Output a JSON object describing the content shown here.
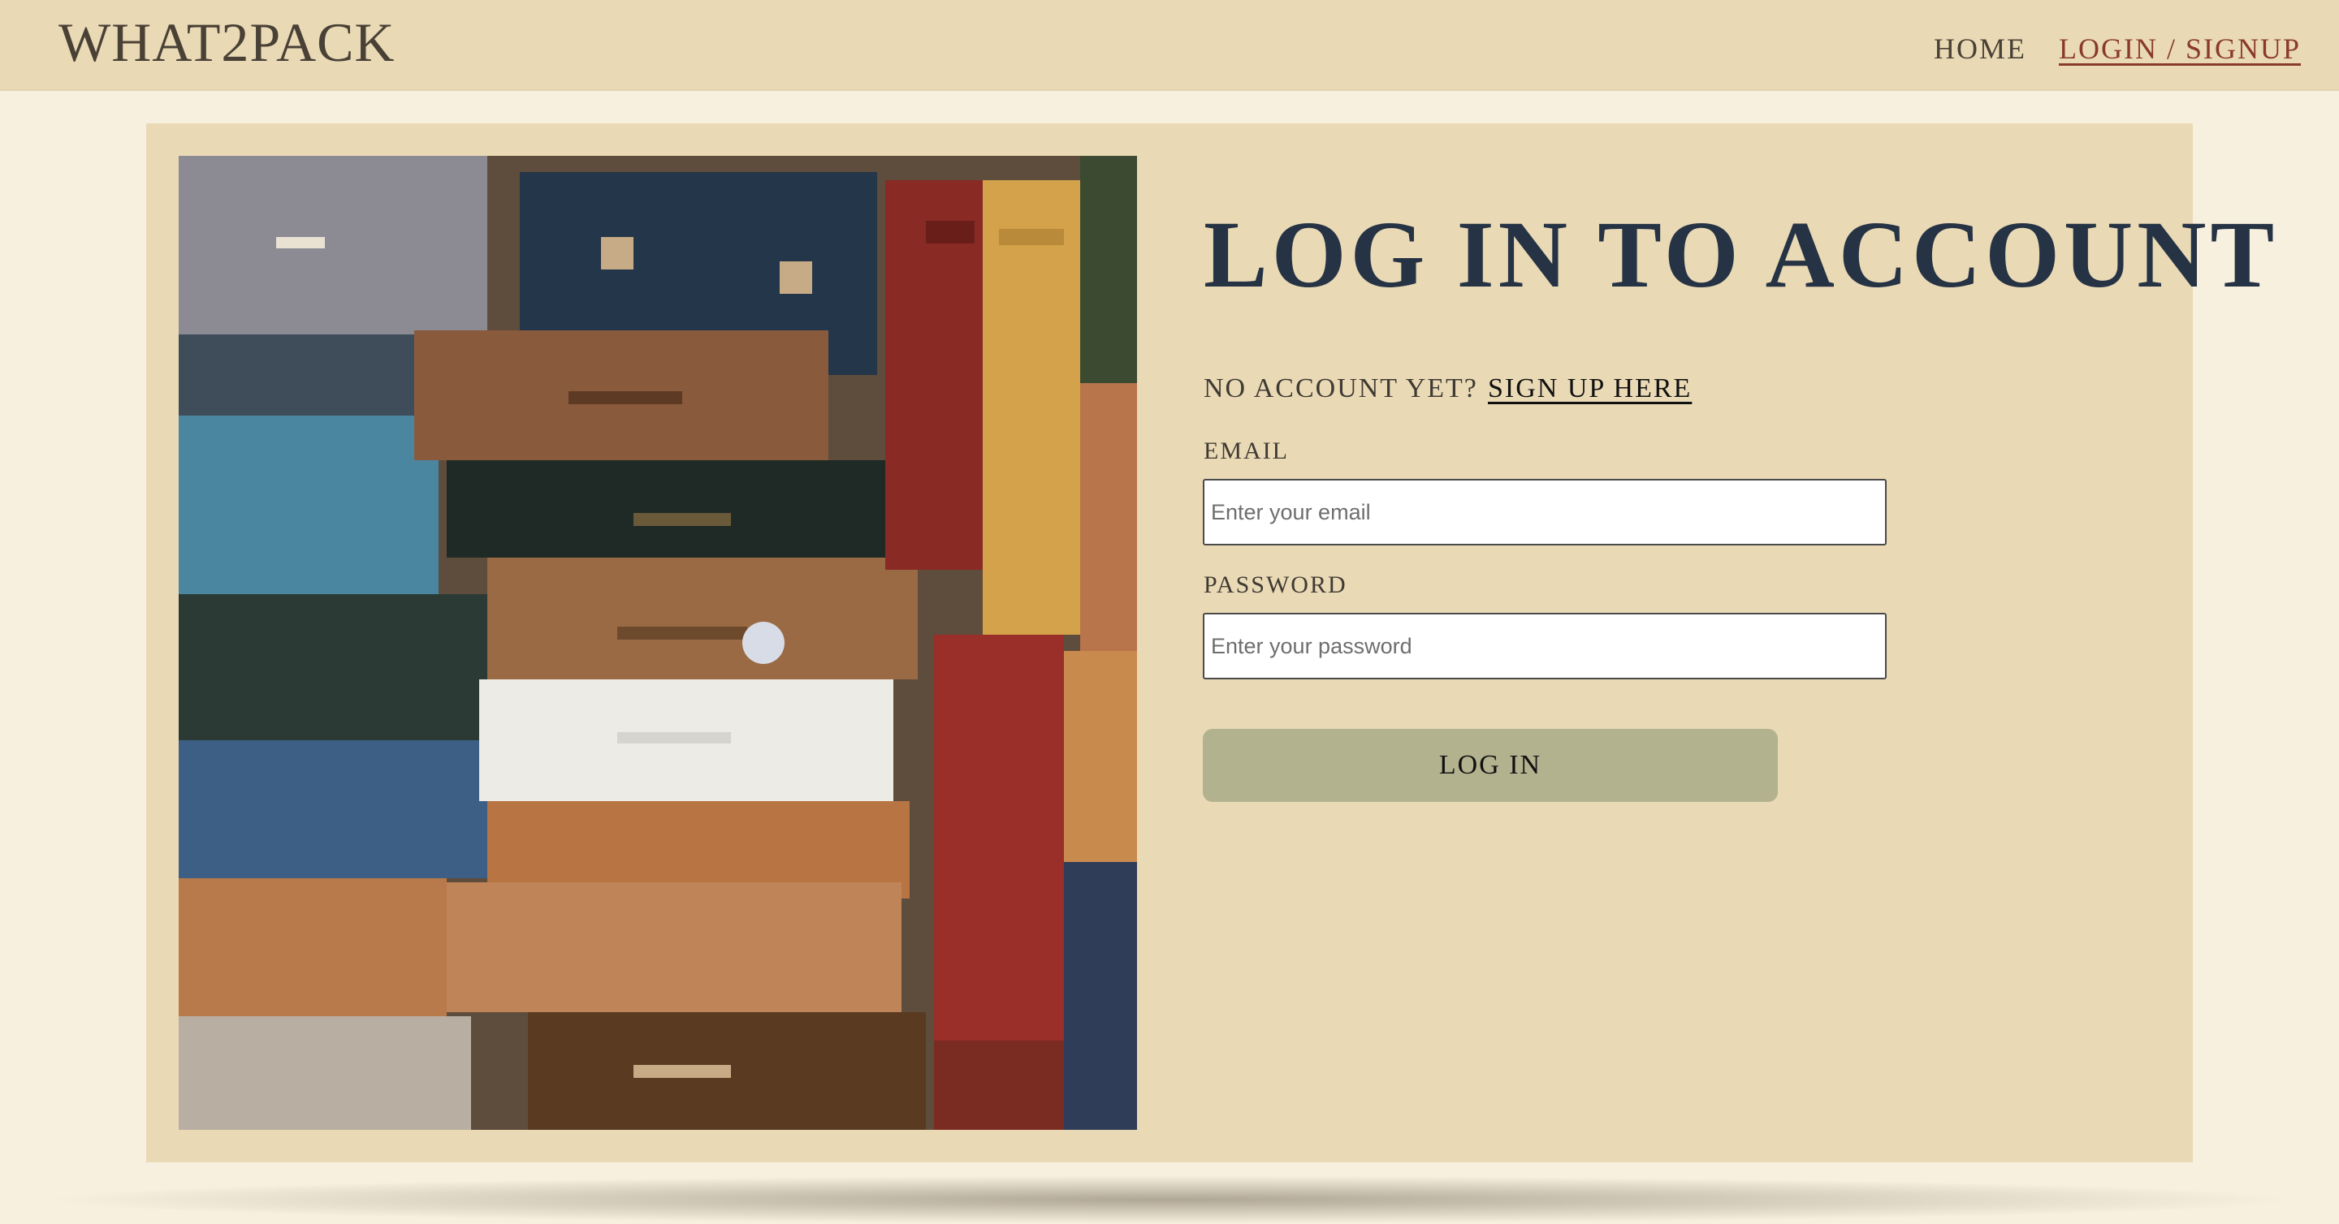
{
  "nav": {
    "brand": "WHAT2PACK",
    "home_label": "HOME",
    "login_label": "LOGIN / SIGNUP"
  },
  "login": {
    "title": "LOG IN TO ACCOUNT",
    "no_account_text": "NO ACCOUNT YET?",
    "signup_link": "SIGN UP HERE",
    "email_label": "EMAIL",
    "email_placeholder": "Enter your email",
    "email_value": "",
    "password_label": "PASSWORD",
    "password_placeholder": "Enter your password",
    "password_value": "",
    "submit_label": "LOG IN"
  },
  "colors": {
    "page_background": "#f8f0df",
    "header_background": "#e9d9b5",
    "card_background": "#e9d9b5",
    "title_color": "#263345",
    "active_nav_color": "#8a3a2a",
    "button_color": "#b2b28f"
  },
  "image": {
    "subject": "stacked-vintage-suitcases-photo"
  }
}
